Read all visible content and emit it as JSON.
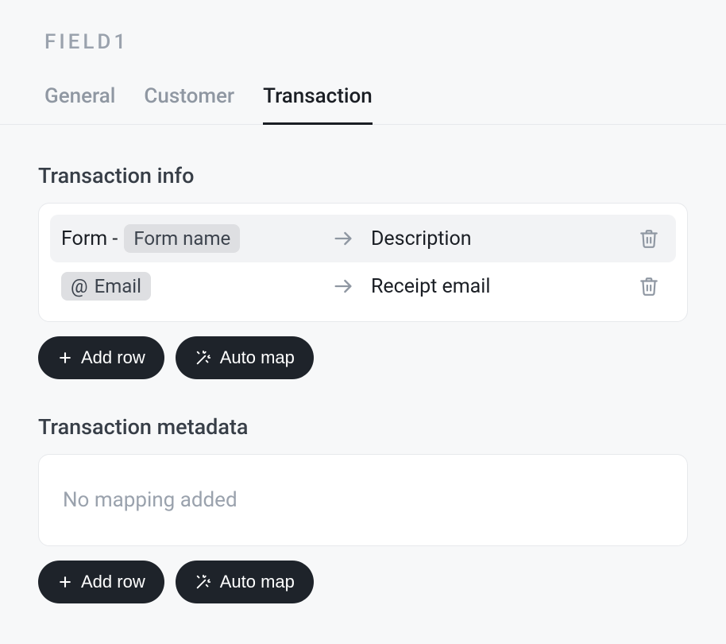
{
  "pageTitle": "FIELD1",
  "tabs": {
    "general": "General",
    "customer": "Customer",
    "transaction": "Transaction"
  },
  "sections": {
    "info": {
      "title": "Transaction info",
      "rows": [
        {
          "prefix": "Form -",
          "chipLabel": "Form name",
          "target": "Description"
        },
        {
          "chipIcon": "@",
          "chipLabel": "Email",
          "target": "Receipt email"
        }
      ]
    },
    "metadata": {
      "title": "Transaction metadata",
      "empty": "No mapping added"
    }
  },
  "buttons": {
    "addRow": "Add row",
    "autoMap": "Auto map"
  }
}
